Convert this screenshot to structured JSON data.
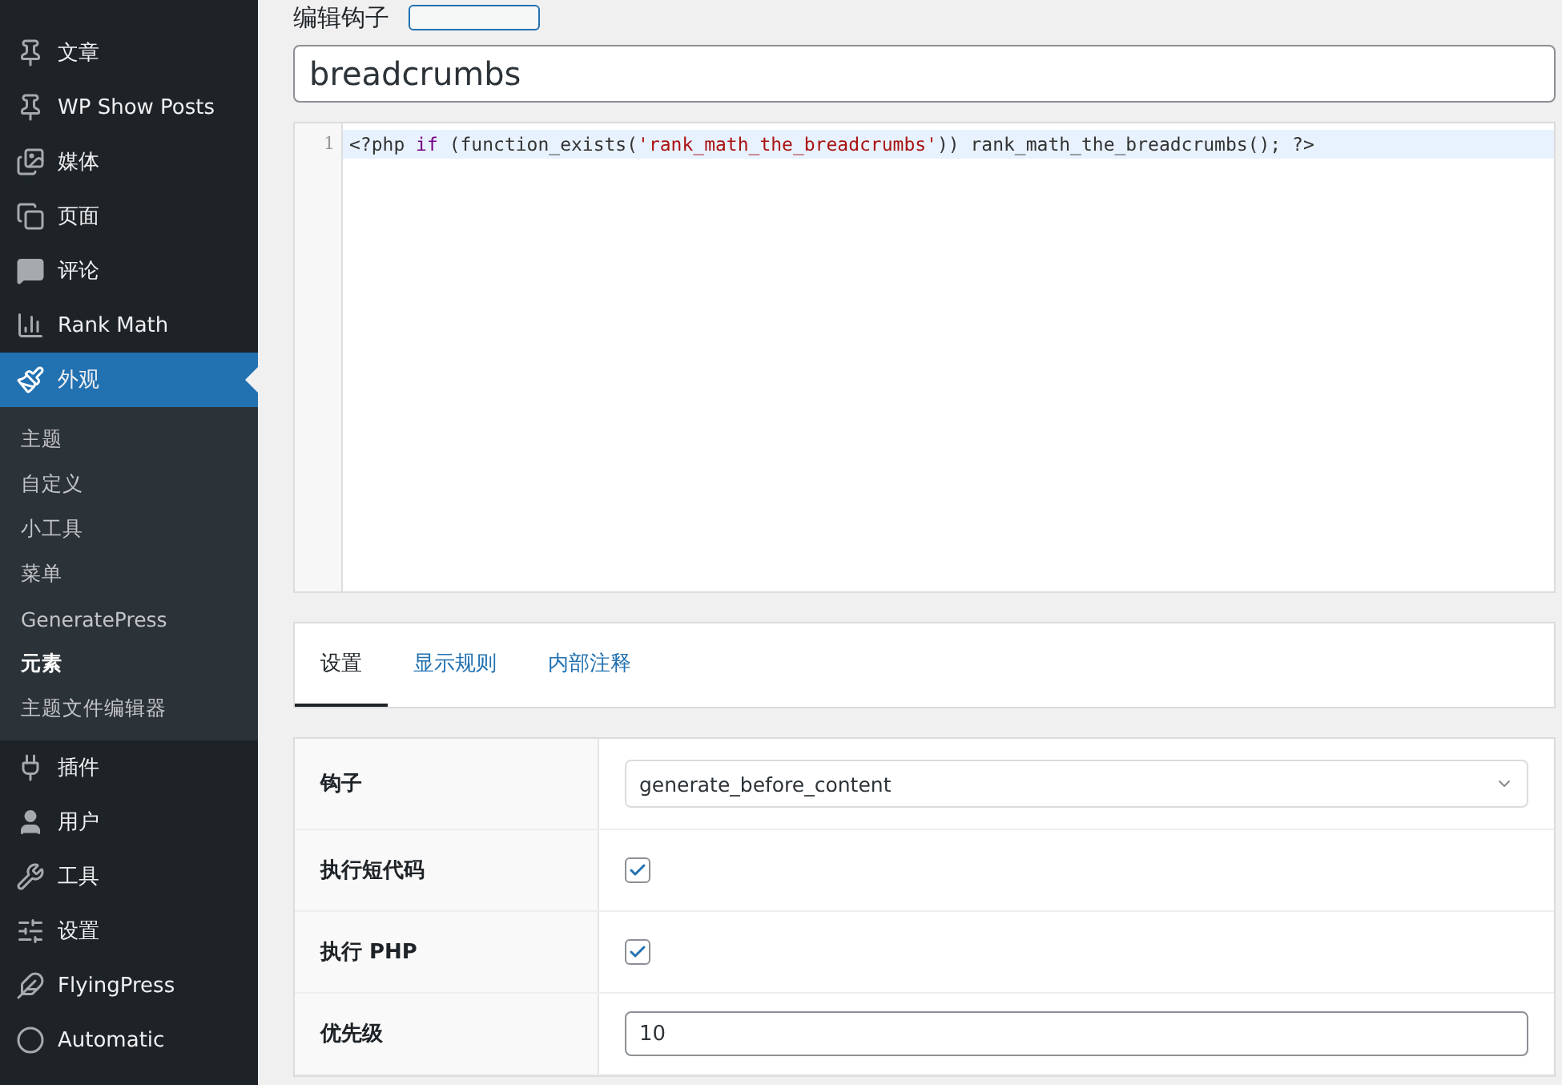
{
  "sidebar": {
    "items": [
      {
        "label": "文章",
        "selected": false
      },
      {
        "label": "WP Show Posts",
        "selected": false
      },
      {
        "label": "媒体",
        "selected": false
      },
      {
        "label": "页面",
        "selected": false
      },
      {
        "label": "评论",
        "selected": false
      },
      {
        "label": "Rank Math",
        "selected": false
      },
      {
        "label": "外观",
        "selected": true,
        "children": [
          {
            "label": "主题",
            "selected": false
          },
          {
            "label": "自定义",
            "selected": false
          },
          {
            "label": "小工具",
            "selected": false
          },
          {
            "label": "菜单",
            "selected": false
          },
          {
            "label": "GeneratePress",
            "selected": false
          },
          {
            "label": "元素",
            "selected": true
          },
          {
            "label": "主题文件编辑器",
            "selected": false
          }
        ]
      },
      {
        "label": "插件",
        "selected": false
      },
      {
        "label": "用户",
        "selected": false
      },
      {
        "label": "工具",
        "selected": false
      },
      {
        "label": "设置",
        "selected": false
      },
      {
        "label": "FlyingPress",
        "selected": false
      },
      {
        "label": "Automatic",
        "selected": false
      }
    ]
  },
  "heading": "编辑钩子",
  "title_field": {
    "value": "breadcrumbs"
  },
  "code_editor": {
    "lines": [
      {
        "number": "1",
        "active": true,
        "tokens": [
          {
            "text": "<?php ",
            "kind": "plain"
          },
          {
            "text": "if",
            "kind": "keyword"
          },
          {
            "text": " (function_exists(",
            "kind": "plain"
          },
          {
            "text": "'rank_math_the_breadcrumbs'",
            "kind": "string"
          },
          {
            "text": ")) rank_math_the_breadcrumbs(); ?>",
            "kind": "plain"
          }
        ]
      }
    ]
  },
  "tabs": [
    {
      "label": "设置",
      "selected": true
    },
    {
      "label": "显示规则",
      "selected": false
    },
    {
      "label": "内部注释",
      "selected": false
    }
  ],
  "settings": [
    {
      "kind": "select",
      "label": "钩子",
      "value": "generate_before_content"
    },
    {
      "kind": "checkbox",
      "label": "执行短代码",
      "checked": true
    },
    {
      "kind": "checkbox",
      "label": "执行 PHP",
      "checked": true
    },
    {
      "kind": "input",
      "label": "优先级",
      "value": "10"
    }
  ]
}
